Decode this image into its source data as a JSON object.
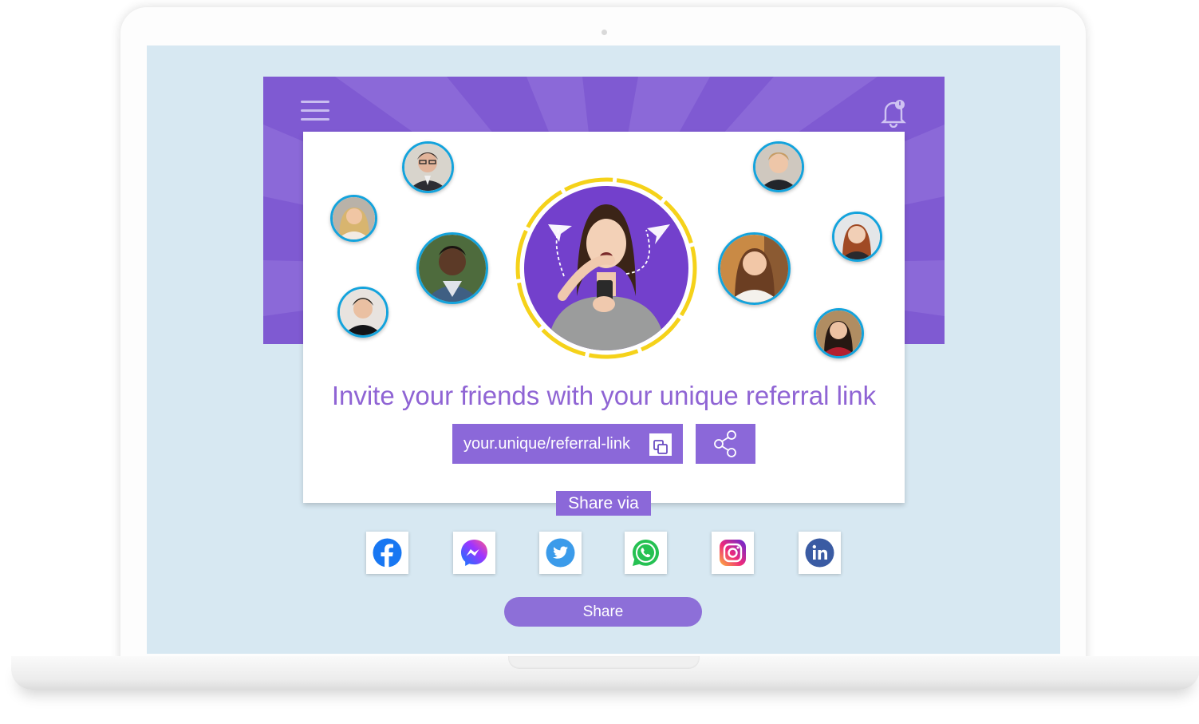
{
  "hero": {
    "headline": "Invite your friends with your unique referral link"
  },
  "referral": {
    "link": "your.unique/referral-link"
  },
  "share": {
    "via_label": "Share via",
    "button_label": "Share",
    "networks": [
      "facebook-icon",
      "messenger-icon",
      "twitter-icon",
      "whatsapp-icon",
      "instagram-icon",
      "linkedin-icon"
    ]
  },
  "colors": {
    "accent_purple": "#8b68d9",
    "banner_purple": "#7f5ad2",
    "headline_purple": "#8f64d4",
    "avatar_ring_blue": "#14a3dc",
    "hero_ring_yellow": "#f5d21a",
    "screen_background": "#d7e8f2"
  }
}
